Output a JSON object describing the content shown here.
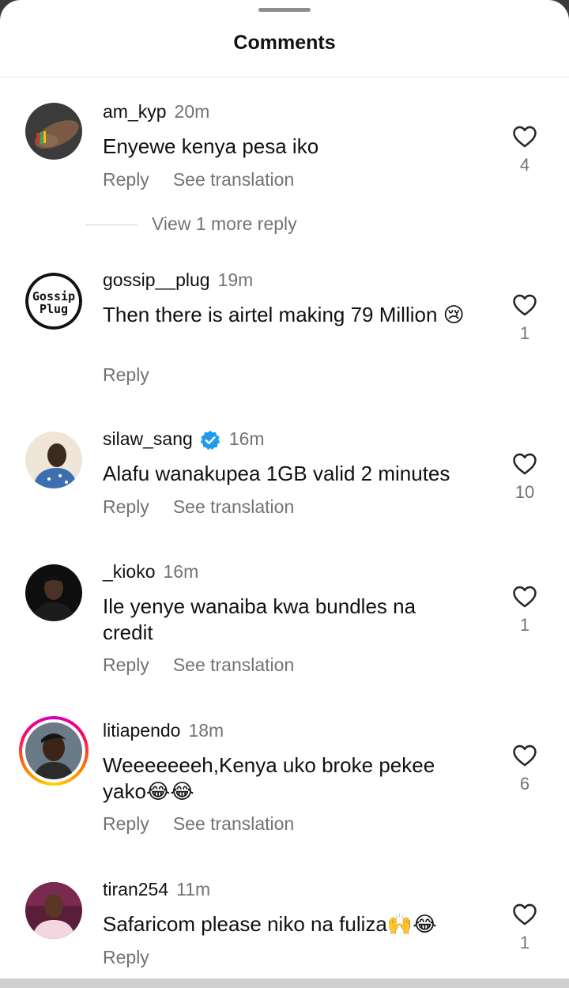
{
  "sheet": {
    "title": "Comments"
  },
  "comments": [
    {
      "username": "am_kyp",
      "time": "20m",
      "verified": false,
      "text": "Enyewe kenya pesa iko",
      "emoji": "",
      "reply_label": "Reply",
      "translation_label": "See translation",
      "likes": "4",
      "more_replies": "View 1 more reply"
    },
    {
      "username": "gossip__plug",
      "time": "19m",
      "verified": false,
      "text": "Then there is airtel making 79 Million",
      "emoji": "😢",
      "reply_label": "Reply",
      "translation_label": "",
      "likes": "1",
      "avatar_logo_lines": [
        "Gossip",
        "Plug"
      ]
    },
    {
      "username": "silaw_sang",
      "time": "16m",
      "verified": true,
      "text": "Alafu wanakupea 1GB valid 2 minutes",
      "emoji": "",
      "reply_label": "Reply",
      "translation_label": "See translation",
      "likes": "10"
    },
    {
      "username": "_kioko",
      "time": "16m",
      "verified": false,
      "text": "Ile yenye wanaiba kwa bundles na credit",
      "emoji": "",
      "reply_label": "Reply",
      "translation_label": "See translation",
      "likes": "1"
    },
    {
      "username": "litiapendo",
      "time": "18m",
      "verified": false,
      "text": "Weeeeeeeh,Kenya uko broke pekee yako",
      "emoji": "😂😂",
      "reply_label": "Reply",
      "translation_label": "See translation",
      "likes": "6",
      "story_ring": true
    },
    {
      "username": "tiran254",
      "time": "11m",
      "verified": false,
      "text": "Safaricom please niko na fuliza",
      "emoji": "🙌😂",
      "reply_label": "Reply",
      "translation_label": "",
      "likes": "1"
    }
  ],
  "icons": {
    "heart": "heart-outline-icon",
    "verified": "verified-badge-icon"
  },
  "colors": {
    "primary_text": "#111111",
    "secondary_text": "#737373",
    "verified_blue": "#1d9bf0"
  }
}
